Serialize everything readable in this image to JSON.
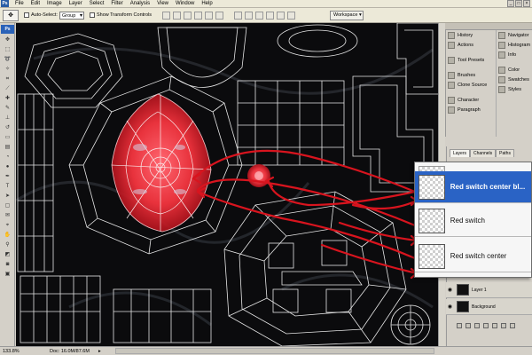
{
  "menubar": {
    "logo": "Ps",
    "items": [
      "File",
      "Edit",
      "Image",
      "Layer",
      "Select",
      "Filter",
      "Analysis",
      "View",
      "Window",
      "Help"
    ]
  },
  "options": {
    "auto_select_label": "Auto-Select:",
    "auto_select_value": "Group",
    "show_transform_label": "Show Transform Controls",
    "workspace_label": "Workspace"
  },
  "toolbox": {
    "badge": "Ps"
  },
  "panels": {
    "dock_a": [
      "History",
      "Actions",
      "Tool Presets",
      "Brushes",
      "Clone Source",
      "Character",
      "Paragraph"
    ],
    "dock_b": [
      "Navigator",
      "Histogram",
      "Info",
      "Color",
      "Swatches",
      "Styles"
    ]
  },
  "layers": {
    "tabs": [
      "Layers",
      "Channels",
      "Paths"
    ],
    "zoomed_rows": [
      "Red switch center bl...",
      "Red switch",
      "Red switch center"
    ],
    "small_rows": [
      "Layer 1",
      "Background"
    ]
  },
  "status": {
    "zoom": "133.8%",
    "doc": "Doc: 16.0M/87.6M"
  },
  "colors": {
    "accent_red": "#e53c46",
    "selection_blue": "#2a63c5",
    "wire": "#e8e8e8"
  }
}
